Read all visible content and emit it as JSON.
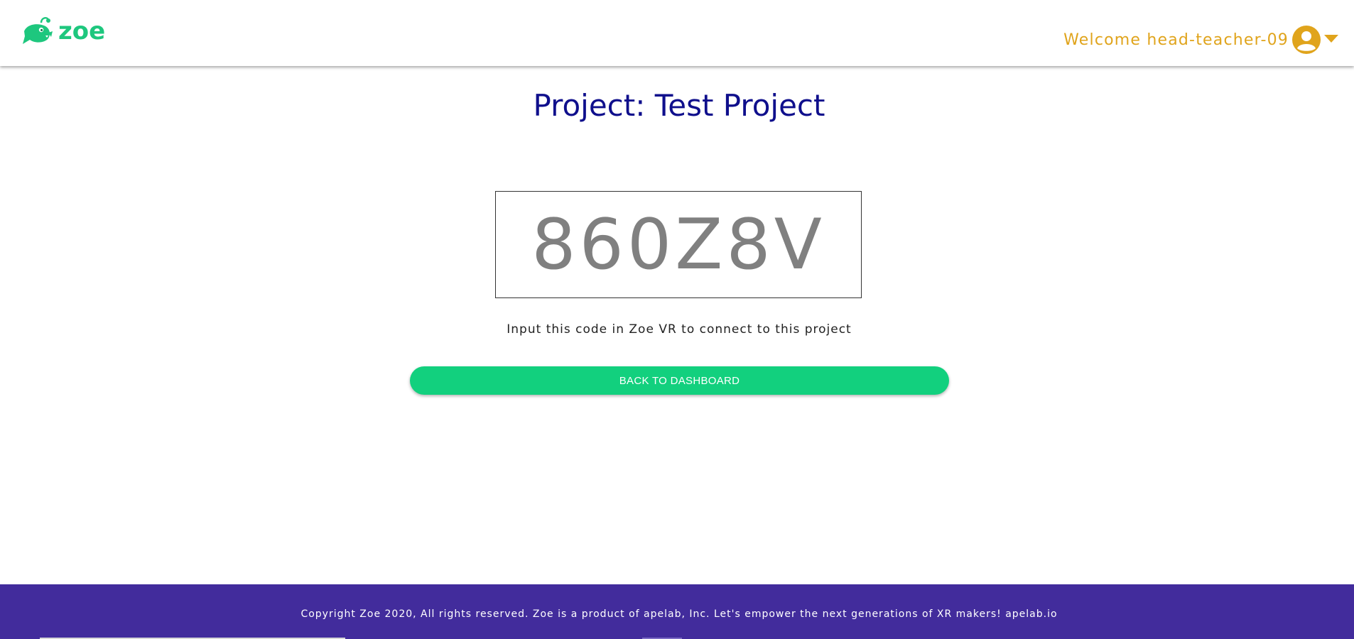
{
  "app": {
    "logo_text": "zoe",
    "brand_color": "#1ec77e"
  },
  "header": {
    "welcome_text": "Welcome head-teacher-09",
    "avatar_icon": "user-circle-icon",
    "caret_icon": "caret-down-icon",
    "accent_color": "#e0a41c"
  },
  "main": {
    "title": "Project: Test Project",
    "project_code": "860Z8V",
    "hint": "Input this code in Zoe VR to connect to this project",
    "back_button_label": "BACK TO DASHBOARD",
    "title_color": "#0f0f8c",
    "button_color": "#12d07e"
  },
  "footer": {
    "copyright": "Copyright Zoe 2020, All rights reserved. Zoe is a product of apelab, Inc. Let's empower the next generations of XR makers! apelab.io",
    "background_color": "#422c9c"
  }
}
